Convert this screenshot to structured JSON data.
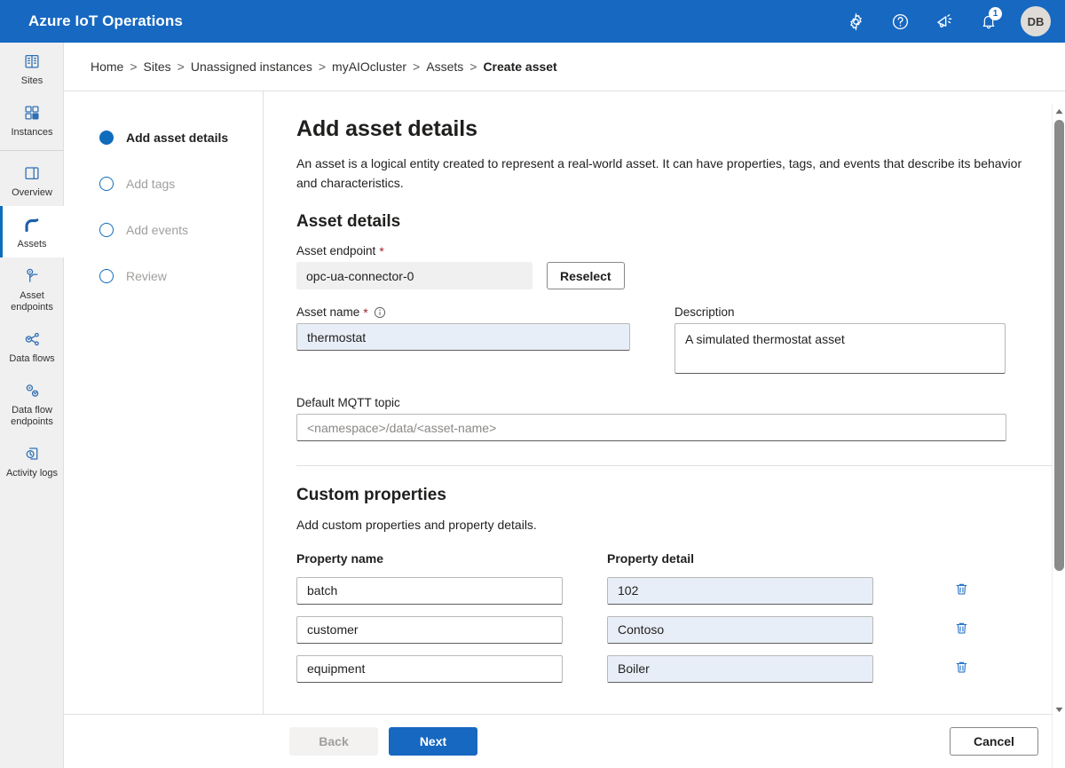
{
  "header": {
    "title": "Azure IoT Operations",
    "brand_color": "#1668c1",
    "icons": [
      {
        "name": "gear-icon",
        "label": "Settings"
      },
      {
        "name": "help-icon",
        "label": "Help"
      },
      {
        "name": "feedback-icon",
        "label": "Feedback"
      },
      {
        "name": "notification-bell-icon",
        "label": "Notifications"
      }
    ],
    "notification_count": "1",
    "avatar_initials": "DB"
  },
  "sidebar": {
    "items": [
      {
        "label": "Sites",
        "icon": "sites-icon",
        "selected": false
      },
      {
        "label": "Instances",
        "icon": "instances-icon",
        "selected": false
      },
      {
        "label": "Overview",
        "icon": "overview-icon",
        "selected": false
      },
      {
        "label": "Assets",
        "icon": "assets-icon",
        "selected": true
      },
      {
        "label": "Asset endpoints",
        "icon": "asset-endpoints-icon",
        "selected": false
      },
      {
        "label": "Data flows",
        "icon": "data-flows-icon",
        "selected": false
      },
      {
        "label": "Data flow endpoints",
        "icon": "data-flow-endpoints-icon",
        "selected": false
      },
      {
        "label": "Activity logs",
        "icon": "activity-logs-icon",
        "selected": false
      }
    ]
  },
  "breadcrumb": {
    "items": [
      "Home",
      "Sites",
      "Unassigned instances",
      "myAIOcluster",
      "Assets",
      "Create asset"
    ],
    "separator": ">",
    "current": "Create asset"
  },
  "wizard": {
    "steps": [
      {
        "label": "Add asset details",
        "active": true
      },
      {
        "label": "Add tags",
        "active": false
      },
      {
        "label": "Add events",
        "active": false
      },
      {
        "label": "Review",
        "active": false
      }
    ]
  },
  "main": {
    "title": "Add asset details",
    "description": "An asset is a logical entity created to represent a real-world asset. It can have properties, tags, and events that describe its behavior and characteristics.",
    "asset_details_heading": "Asset details",
    "asset_endpoint": {
      "label": "Asset endpoint",
      "required_marker": "*",
      "value": "opc-ua-connector-0",
      "reselect_label": "Reselect"
    },
    "asset_name": {
      "label": "Asset name",
      "required_marker": "*",
      "info_icon": "info-icon",
      "value": "thermostat"
    },
    "description_field": {
      "label": "Description",
      "value": "A simulated thermostat asset"
    },
    "mqtt_topic": {
      "label": "Default MQTT topic",
      "value": "",
      "placeholder": "<namespace>/data/<asset-name>"
    }
  },
  "custom_properties": {
    "heading": "Custom properties",
    "description": "Add custom properties and property details.",
    "columns": [
      "Property name",
      "Property detail"
    ],
    "delete_icon": "trash-icon",
    "rows": [
      {
        "name": "batch",
        "detail": "102"
      },
      {
        "name": "customer",
        "detail": "Contoso"
      },
      {
        "name": "equipment",
        "detail": "Boiler"
      }
    ]
  },
  "footer": {
    "back_label": "Back",
    "back_disabled": true,
    "next_label": "Next",
    "cancel_label": "Cancel"
  }
}
